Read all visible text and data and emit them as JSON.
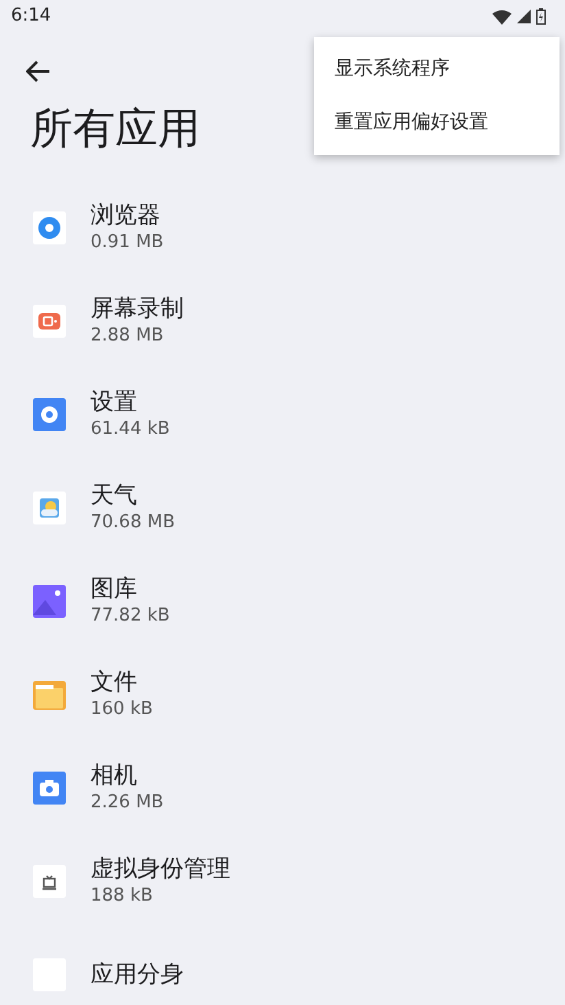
{
  "status_bar": {
    "time": "6:14"
  },
  "title": "所有应用",
  "apps": [
    {
      "name": "浏览器",
      "size": "0.91 MB"
    },
    {
      "name": "屏幕录制",
      "size": "2.88 MB"
    },
    {
      "name": "设置",
      "size": "61.44 kB"
    },
    {
      "name": "天气",
      "size": "70.68 MB"
    },
    {
      "name": "图库",
      "size": "77.82 kB"
    },
    {
      "name": "文件",
      "size": "160 kB"
    },
    {
      "name": "相机",
      "size": "2.26 MB"
    },
    {
      "name": "虚拟身份管理",
      "size": "188 kB"
    },
    {
      "name": "应用分身"
    }
  ],
  "menu": {
    "items": [
      "显示系统程序",
      "重置应用偏好设置"
    ]
  }
}
